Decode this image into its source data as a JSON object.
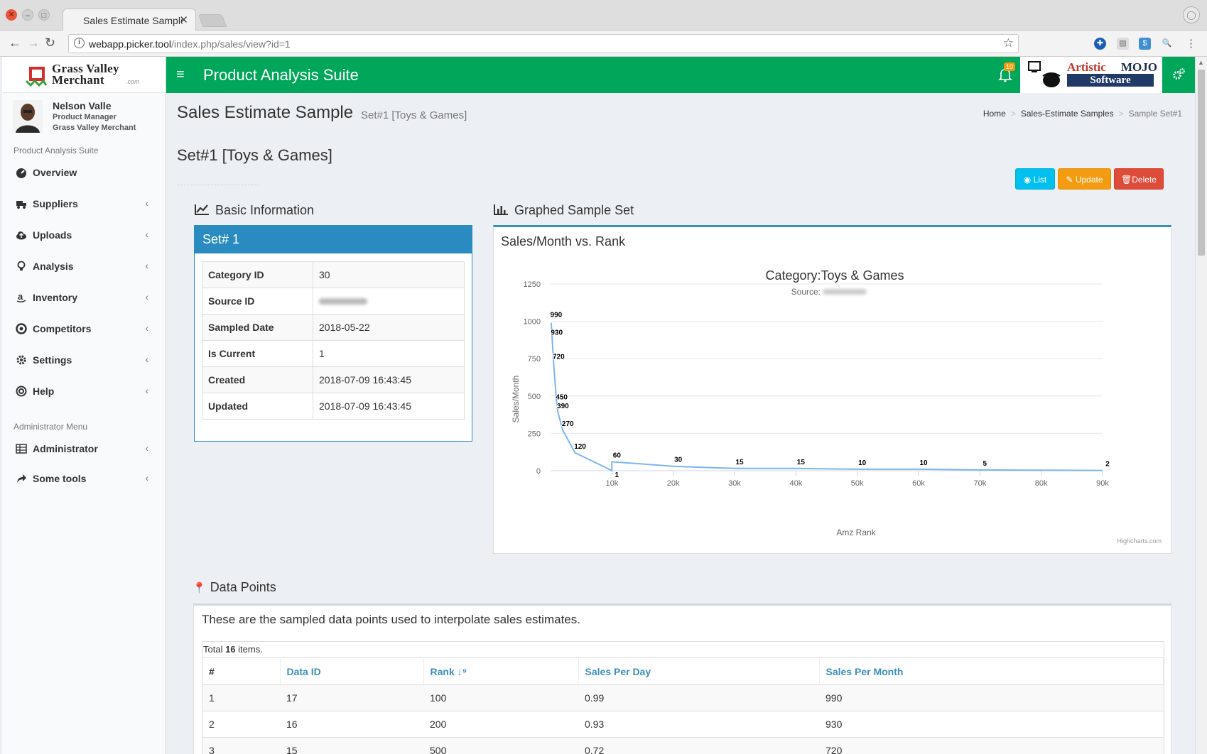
{
  "browser": {
    "tab_title": "Sales Estimate Sample",
    "url_host": "webapp.picker.tool",
    "url_path": "/index.php/sales/view?id=1"
  },
  "brand": {
    "logo_line1": "Grass Valley",
    "logo_line2": "Merchant",
    "logo_suffix": ".com",
    "partner_name1": "Artistic",
    "partner_name2": "MOJO",
    "partner_name3": "Software"
  },
  "user": {
    "name": "Nelson Valle",
    "role": "Product Manager",
    "org": "Grass Valley Merchant"
  },
  "sidebar": {
    "header_main": "Product Analysis Suite",
    "header_admin": "Administrator Menu",
    "items": [
      {
        "label": "Overview",
        "icon": "dashboard-icon"
      },
      {
        "label": "Suppliers",
        "icon": "truck-icon"
      },
      {
        "label": "Uploads",
        "icon": "cloud-upload-icon"
      },
      {
        "label": "Analysis",
        "icon": "lightbulb-icon"
      },
      {
        "label": "Inventory",
        "icon": "amazon-icon"
      },
      {
        "label": "Competitors",
        "icon": "life-ring-icon"
      },
      {
        "label": "Settings",
        "icon": "gear-icon"
      },
      {
        "label": "Help",
        "icon": "help-ring-icon"
      }
    ],
    "admin_items": [
      {
        "label": "Administrator",
        "icon": "table-icon"
      },
      {
        "label": "Some tools",
        "icon": "share-icon"
      }
    ]
  },
  "header": {
    "title": "Product Analysis Suite",
    "notification_count": "10"
  },
  "page": {
    "title": "Sales Estimate Sample",
    "subtitle": "Set#1 [Toys & Games]",
    "breadcrumb": [
      "Home",
      "Sales-Estimate Samples",
      "Sample Set#1"
    ],
    "section_title": "Set#1 [Toys & Games]",
    "buttons": {
      "list": "List",
      "update": "Update",
      "delete": "Delete"
    }
  },
  "basic_info": {
    "heading": "Basic Information",
    "panel_title": "Set# 1",
    "rows": [
      {
        "label": "Category ID",
        "value": "30"
      },
      {
        "label": "Source ID",
        "value": ""
      },
      {
        "label": "Sampled Date",
        "value": "2018-05-22"
      },
      {
        "label": "Is Current",
        "value": "1"
      },
      {
        "label": "Created",
        "value": "2018-07-09 16:43:45"
      },
      {
        "label": "Updated",
        "value": "2018-07-09 16:43:45"
      }
    ]
  },
  "graph": {
    "heading": "Graphed Sample Set",
    "box_title": "Sales/Month vs. Rank",
    "credit": "Highcharts.com"
  },
  "chart_data": {
    "type": "line",
    "title": "Category:Toys & Games",
    "subtitle": "Source:",
    "xlabel": "Amz Rank",
    "ylabel": "Sales/Month",
    "xlim": [
      0,
      90000
    ],
    "ylim": [
      0,
      1250
    ],
    "x_ticks": [
      "10k",
      "20k",
      "30k",
      "40k",
      "50k",
      "60k",
      "70k",
      "80k",
      "90k"
    ],
    "y_ticks": [
      "0",
      "250",
      "500",
      "750",
      "1000",
      "1250"
    ],
    "grid": true,
    "color": "#7cb5ec",
    "x": [
      100,
      200,
      500,
      1000,
      1200,
      2000,
      4000,
      10000,
      10000,
      20000,
      30000,
      40000,
      50000,
      60000,
      70000,
      90000
    ],
    "y": [
      990,
      930,
      720,
      450,
      390,
      270,
      120,
      1,
      60,
      30,
      15,
      15,
      10,
      10,
      5,
      2
    ]
  },
  "data_points": {
    "heading": "Data Points",
    "intro": "These are the sampled data points used to interpolate sales estimates.",
    "summary_prefix": "Total ",
    "summary_count": "16",
    "summary_suffix": " items.",
    "columns": [
      "#",
      "Data ID",
      "Rank",
      "Sales Per Day",
      "Sales Per Month"
    ],
    "rows": [
      [
        "1",
        "17",
        "100",
        "0.99",
        "990"
      ],
      [
        "2",
        "16",
        "200",
        "0.93",
        "930"
      ],
      [
        "3",
        "15",
        "500",
        "0.72",
        "720"
      ]
    ]
  }
}
